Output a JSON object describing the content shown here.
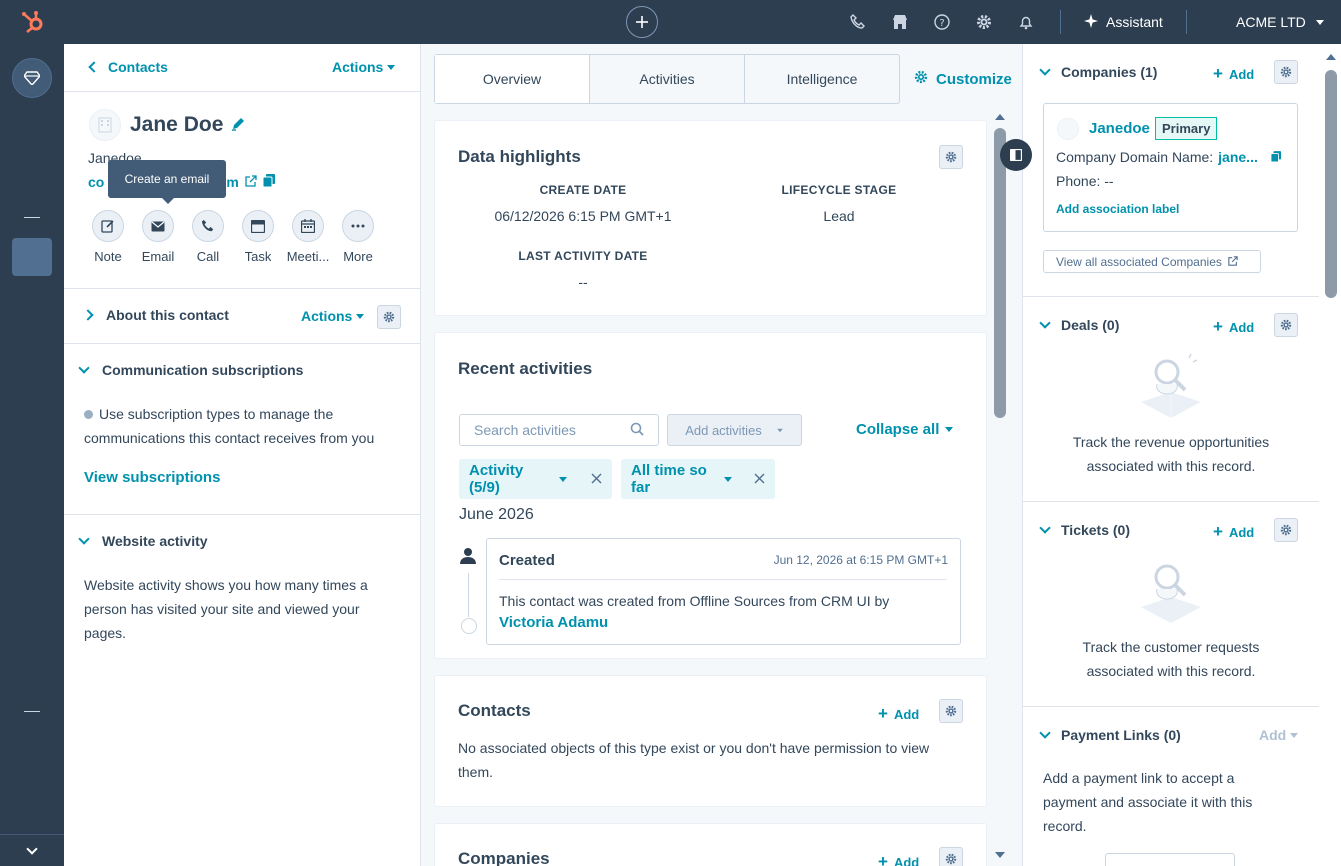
{
  "topnav": {
    "assistant_label": "Assistant",
    "account_label": "ACME LTD",
    "icons": [
      "hubspot-logo",
      "create-plus-icon",
      "phone-icon",
      "marketplace-icon",
      "help-icon",
      "settings-icon",
      "notifications-icon",
      "assistant-sparkle-icon"
    ]
  },
  "left_panel": {
    "back_label": "Contacts",
    "actions_label": "Actions",
    "contact_name": "Jane Doe",
    "username": "Janedoe",
    "email_prefix": "co",
    "email_suffix": "m",
    "tooltip": "Create an email",
    "quick_actions": [
      {
        "label": "Note",
        "icon": "note-icon"
      },
      {
        "label": "Email",
        "icon": "email-icon"
      },
      {
        "label": "Call",
        "icon": "call-icon"
      },
      {
        "label": "Task",
        "icon": "task-icon"
      },
      {
        "label": "Meeti...",
        "icon": "meeting-icon"
      },
      {
        "label": "More",
        "icon": "more-icon"
      }
    ],
    "about": {
      "title": "About this contact",
      "actions_label": "Actions"
    },
    "subscriptions": {
      "title": "Communication subscriptions",
      "text": "Use subscription types to manage the communications this contact receives from you",
      "link": "View subscriptions"
    },
    "website": {
      "title": "Website activity",
      "text": "Website activity shows you how many times a person has visited your site and viewed your pages."
    }
  },
  "middle": {
    "tabs": [
      {
        "label": "Overview",
        "active": true
      },
      {
        "label": "Activities",
        "active": false
      },
      {
        "label": "Intelligence",
        "active": false
      }
    ],
    "customize_label": "Customize",
    "highlights": {
      "title": "Data highlights",
      "create_date_label": "CREATE DATE",
      "create_date_value": "06/12/2026 6:15 PM GMT+1",
      "lifecycle_label": "LIFECYCLE STAGE",
      "lifecycle_value": "Lead",
      "last_activity_label": "LAST ACTIVITY DATE",
      "last_activity_value": "--"
    },
    "recent": {
      "title": "Recent activities",
      "search_placeholder": "Search activities",
      "add_activities_label": "Add activities",
      "collapse_label": "Collapse all",
      "filter_activity": "Activity (5/9)",
      "filter_time": "All time so far",
      "month": "June 2026",
      "item": {
        "title": "Created",
        "timestamp": "Jun 12, 2026 at 6:15 PM GMT+1",
        "text": "This contact was created from Offline Sources from CRM UI by",
        "author": "Victoria Adamu"
      }
    },
    "contacts": {
      "title": "Contacts",
      "add_label": "Add",
      "text": "No associated objects of this type exist or you don't have permission to view them."
    },
    "companies": {
      "title": "Companies",
      "add_label": "Add"
    }
  },
  "right_panel": {
    "companies": {
      "title": "Companies (1)",
      "add_label": "Add",
      "company_name": "Janedoe",
      "primary_badge": "Primary",
      "domain_label": "Company Domain Name:",
      "domain_value": "jane...",
      "phone_label": "Phone: --",
      "assoc_label": "Add association label",
      "view_all": "View all associated Companies"
    },
    "deals": {
      "title": "Deals (0)",
      "add_label": "Add",
      "text": "Track the revenue opportunities associated with this record."
    },
    "tickets": {
      "title": "Tickets (0)",
      "add_label": "Add",
      "text": "Track the customer requests associated with this record."
    },
    "payment_links": {
      "title": "Payment Links (0)",
      "add_label": "Add",
      "text": "Add a payment link to accept a payment and associate it with this record."
    }
  },
  "colors": {
    "nav": "#2d3e50",
    "link": "#0091ae",
    "text": "#33475b",
    "brand_orange": "#ff7a59"
  }
}
